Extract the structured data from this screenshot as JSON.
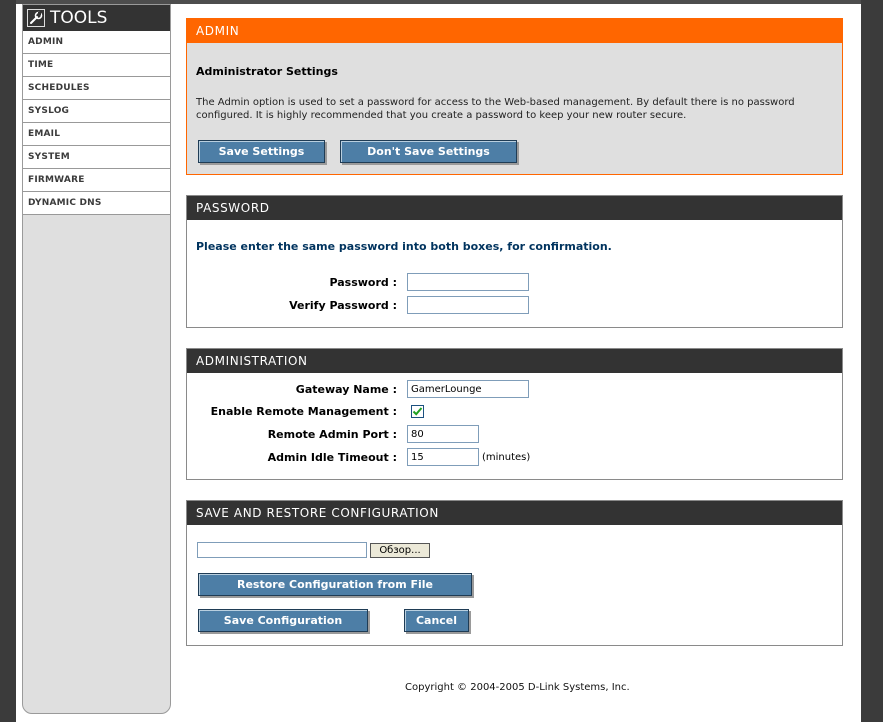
{
  "sidebar": {
    "title": "TOOLS",
    "icon": "wrench-icon",
    "items": [
      {
        "label": "ADMIN"
      },
      {
        "label": "TIME"
      },
      {
        "label": "SCHEDULES"
      },
      {
        "label": "SYSLOG"
      },
      {
        "label": "EMAIL"
      },
      {
        "label": "SYSTEM"
      },
      {
        "label": "FIRMWARE"
      },
      {
        "label": "DYNAMIC DNS"
      }
    ]
  },
  "admin": {
    "heading": "ADMIN",
    "subtitle": "Administrator Settings",
    "description": "The Admin option is used to set a password for access to the Web-based management. By default there is no password configured. It is highly recommended that you create a password to keep your new router secure.",
    "save_label": "Save Settings",
    "dont_save_label": "Don't Save Settings",
    "accent": "#ff6600"
  },
  "password": {
    "heading": "PASSWORD",
    "note": "Please enter the same password into both boxes, for confirmation.",
    "password_label": "Password :",
    "password_value": "",
    "verify_label": "Verify Password :",
    "verify_value": ""
  },
  "administration": {
    "heading": "ADMINISTRATION",
    "gateway_label": "Gateway Name :",
    "gateway_value": "GamerLounge",
    "remote_label": "Enable Remote Management :",
    "remote_checked": true,
    "port_label": "Remote Admin Port :",
    "port_value": "80",
    "timeout_label": "Admin Idle Timeout :",
    "timeout_value": "15",
    "timeout_unit": "(minutes)"
  },
  "restore": {
    "heading": "SAVE AND RESTORE CONFIGURATION",
    "file_value": "",
    "browse_label": "Обзор...",
    "restore_label": "Restore Configuration from File",
    "save_config_label": "Save Configuration",
    "cancel_label": "Cancel"
  },
  "footer": {
    "copyright": "Copyright © 2004-2005 D-Link Systems, Inc."
  },
  "colors": {
    "button": "#4d7ea6",
    "panel_header": "#333333",
    "note_text": "#00335e"
  }
}
